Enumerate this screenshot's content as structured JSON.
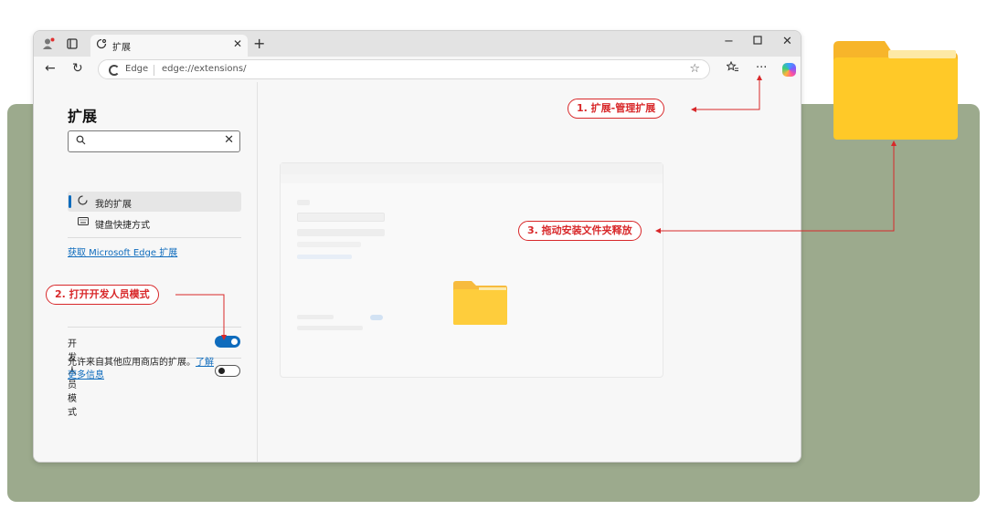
{
  "browser": {
    "tab": {
      "title": "扩展"
    },
    "address": {
      "site_label": "Edge",
      "url": "edge://extensions/"
    }
  },
  "sidebar": {
    "title": "扩展",
    "search": {
      "placeholder": ""
    },
    "items": [
      {
        "label": "我的扩展"
      },
      {
        "label": "键盘快捷方式"
      }
    ],
    "get_extensions_link": "获取 Microsoft Edge 扩展",
    "developer_mode": {
      "label": "开发人员模式",
      "enabled": true
    },
    "allow_other_stores": {
      "label": "允许来自其他应用商店的扩展。",
      "link": "了解更多信息",
      "enabled": false
    }
  },
  "callouts": {
    "step1": "1. 扩展-管理扩展",
    "step2": "2. 打开开发人员模式",
    "step3": "3. 拖动安装文件夹释放"
  },
  "colors": {
    "accent": "#0f6cbd",
    "callout_red": "#d8282a",
    "background_green": "#9caa8d",
    "folder_yellow": "#ffc928"
  }
}
